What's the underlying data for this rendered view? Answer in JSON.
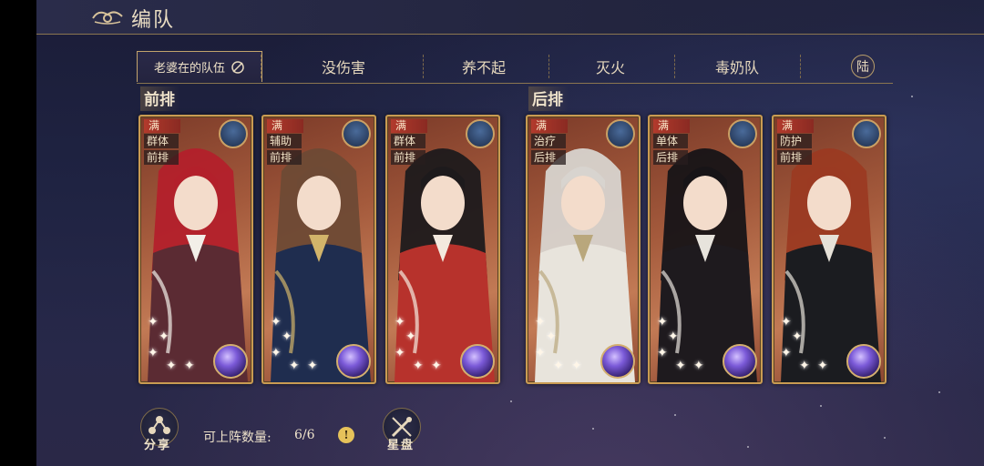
{
  "header": {
    "title": "编队"
  },
  "tabs": [
    {
      "label": "老婆在的队伍",
      "active": true
    },
    {
      "label": "没伤害"
    },
    {
      "label": "养不起"
    },
    {
      "label": "灭火"
    },
    {
      "label": "毒奶队"
    },
    {
      "label": "陆"
    }
  ],
  "sections": {
    "front": "前排",
    "back": "后排"
  },
  "cards": [
    {
      "level": "满",
      "role": "群体",
      "row": "前排",
      "hair": "#b3202b",
      "outfit": "#5b2b33",
      "accent": "#f2efe8"
    },
    {
      "level": "满",
      "role": "辅助",
      "row": "前排",
      "hair": "#6e4a35",
      "outfit": "#1f2d4f",
      "accent": "#d2b46a"
    },
    {
      "level": "满",
      "role": "群体",
      "row": "前排",
      "hair": "#1d1a1c",
      "outfit": "#b7322c",
      "accent": "#f3e9de"
    },
    {
      "level": "满",
      "role": "治疗",
      "row": "后排",
      "hair": "#d8d4cf",
      "outfit": "#e8e4dc",
      "accent": "#b9a77c"
    },
    {
      "level": "满",
      "role": "单体",
      "row": "后排",
      "hair": "#171417",
      "outfit": "#1e1a1e",
      "accent": "#e7e3dc"
    },
    {
      "level": "满",
      "role": "防护",
      "row": "前排",
      "hair": "#9b3a22",
      "outfit": "#1b1c20",
      "accent": "#e6e1d8"
    }
  ],
  "bottom": {
    "share_label": "分享",
    "count_label": "可上阵数量:",
    "count_value": "6/6",
    "info_symbol": "!",
    "starchart_label": "星盘"
  }
}
